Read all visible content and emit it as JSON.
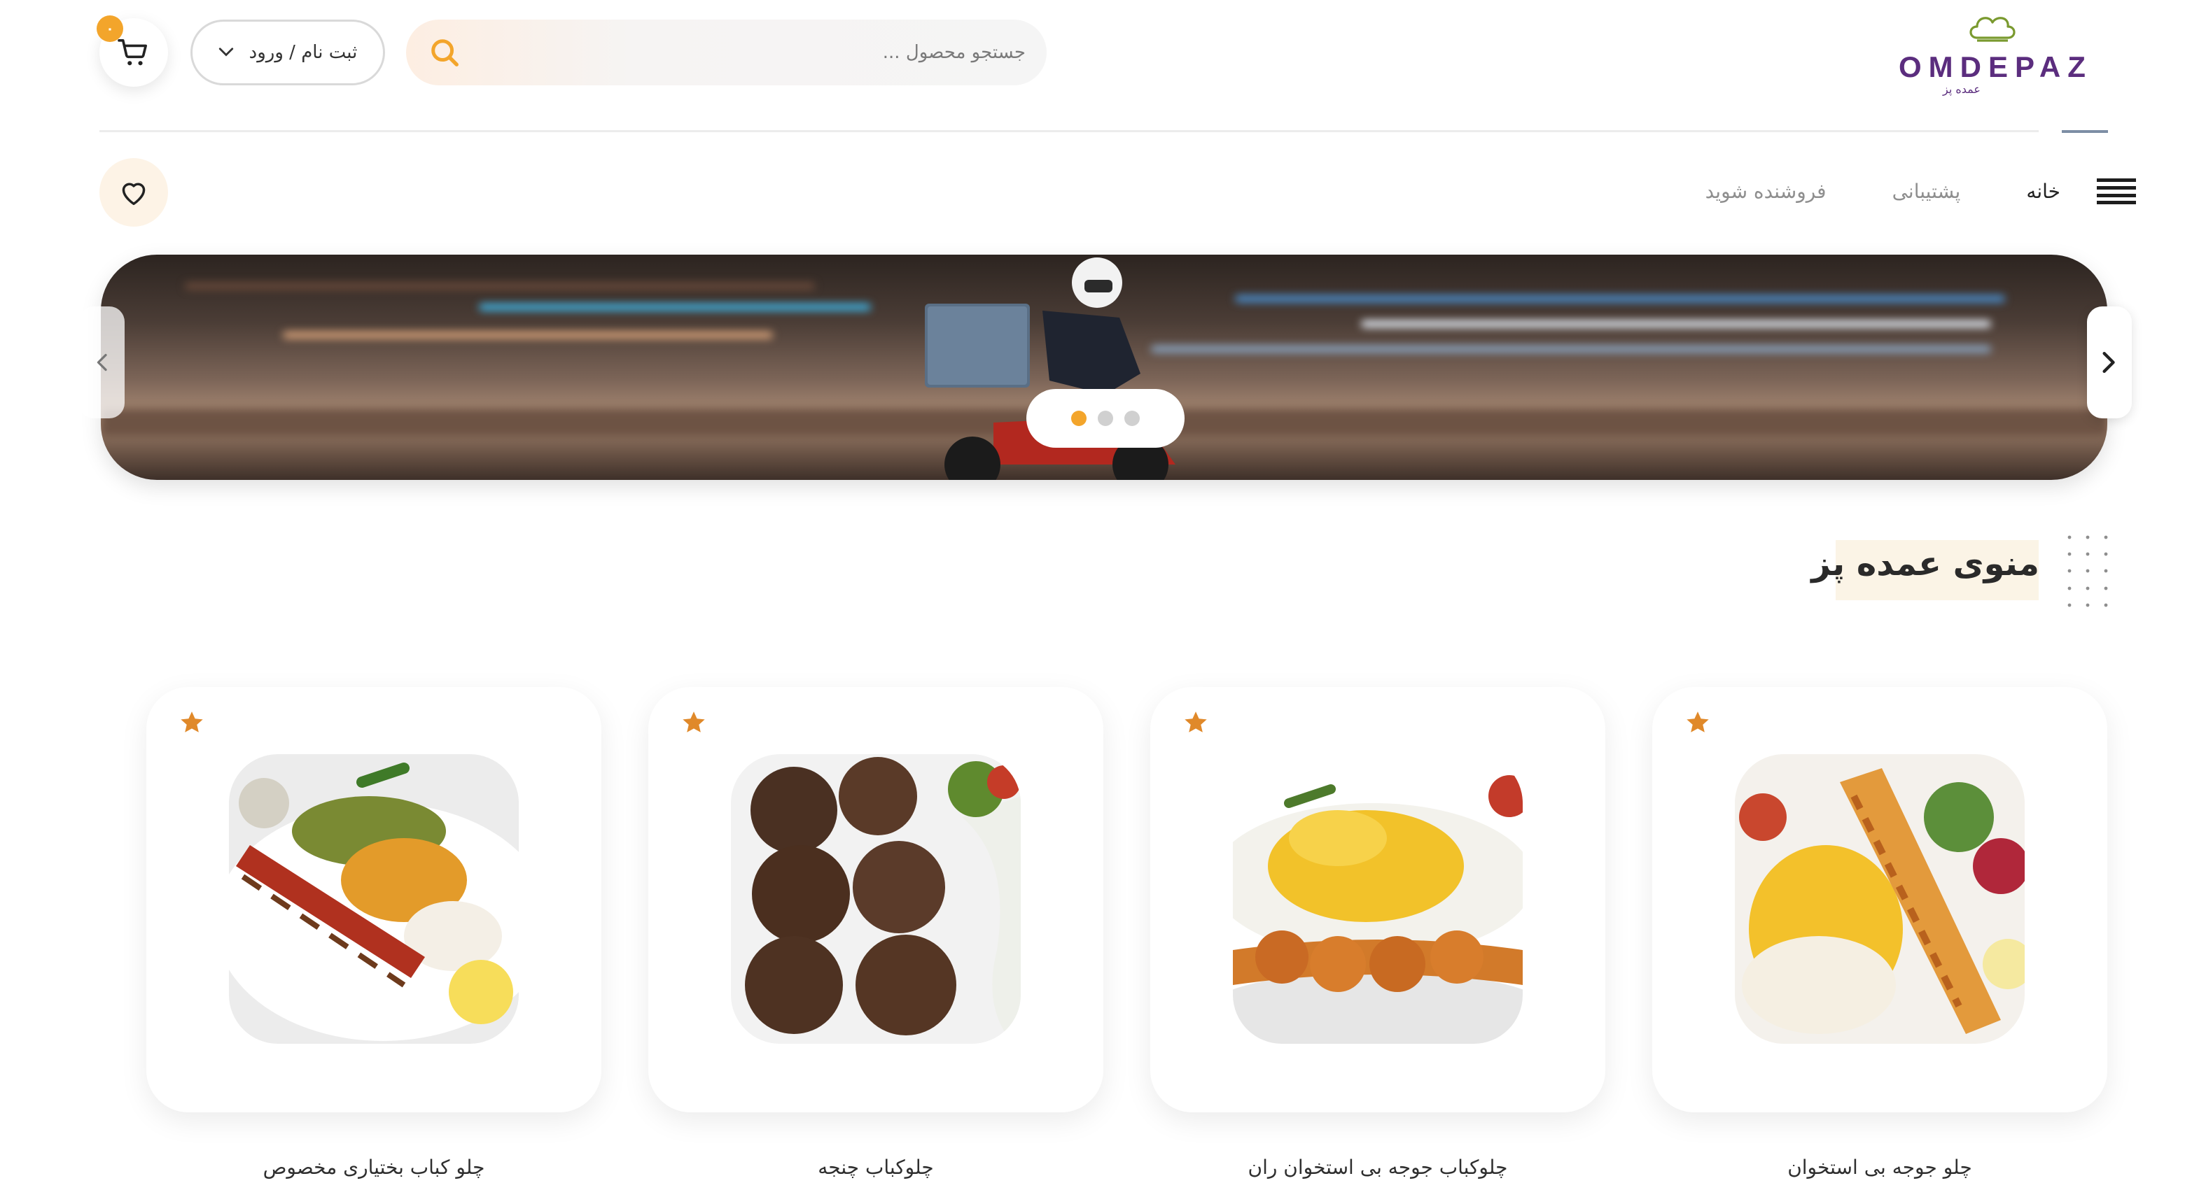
{
  "header": {
    "cart_count": "۰",
    "login_label": "ثبت نام / ورود",
    "search_placeholder": "جستجو محصول ...",
    "logo_text": "OMDEPAZ",
    "logo_subtext": "عمده پز"
  },
  "nav": {
    "items": [
      {
        "label": "خانه",
        "active": true
      },
      {
        "label": "پشتیبانی",
        "active": false
      },
      {
        "label": "فروشنده شوید",
        "active": false
      }
    ]
  },
  "banner": {
    "slide_count": 3,
    "active_slide": 1
  },
  "section": {
    "title": "منوی عمده پز"
  },
  "products": [
    {
      "name": "چلو جوجه بی استخوان"
    },
    {
      "name": "چلوکباب جوجه بی استخوان ران"
    },
    {
      "name": "چلوکباب چنجه"
    },
    {
      "name": "چلو کباب بختیاری مخصوص"
    }
  ],
  "colors": {
    "accent": "#f3a52b",
    "brand": "#5b2d7e"
  }
}
